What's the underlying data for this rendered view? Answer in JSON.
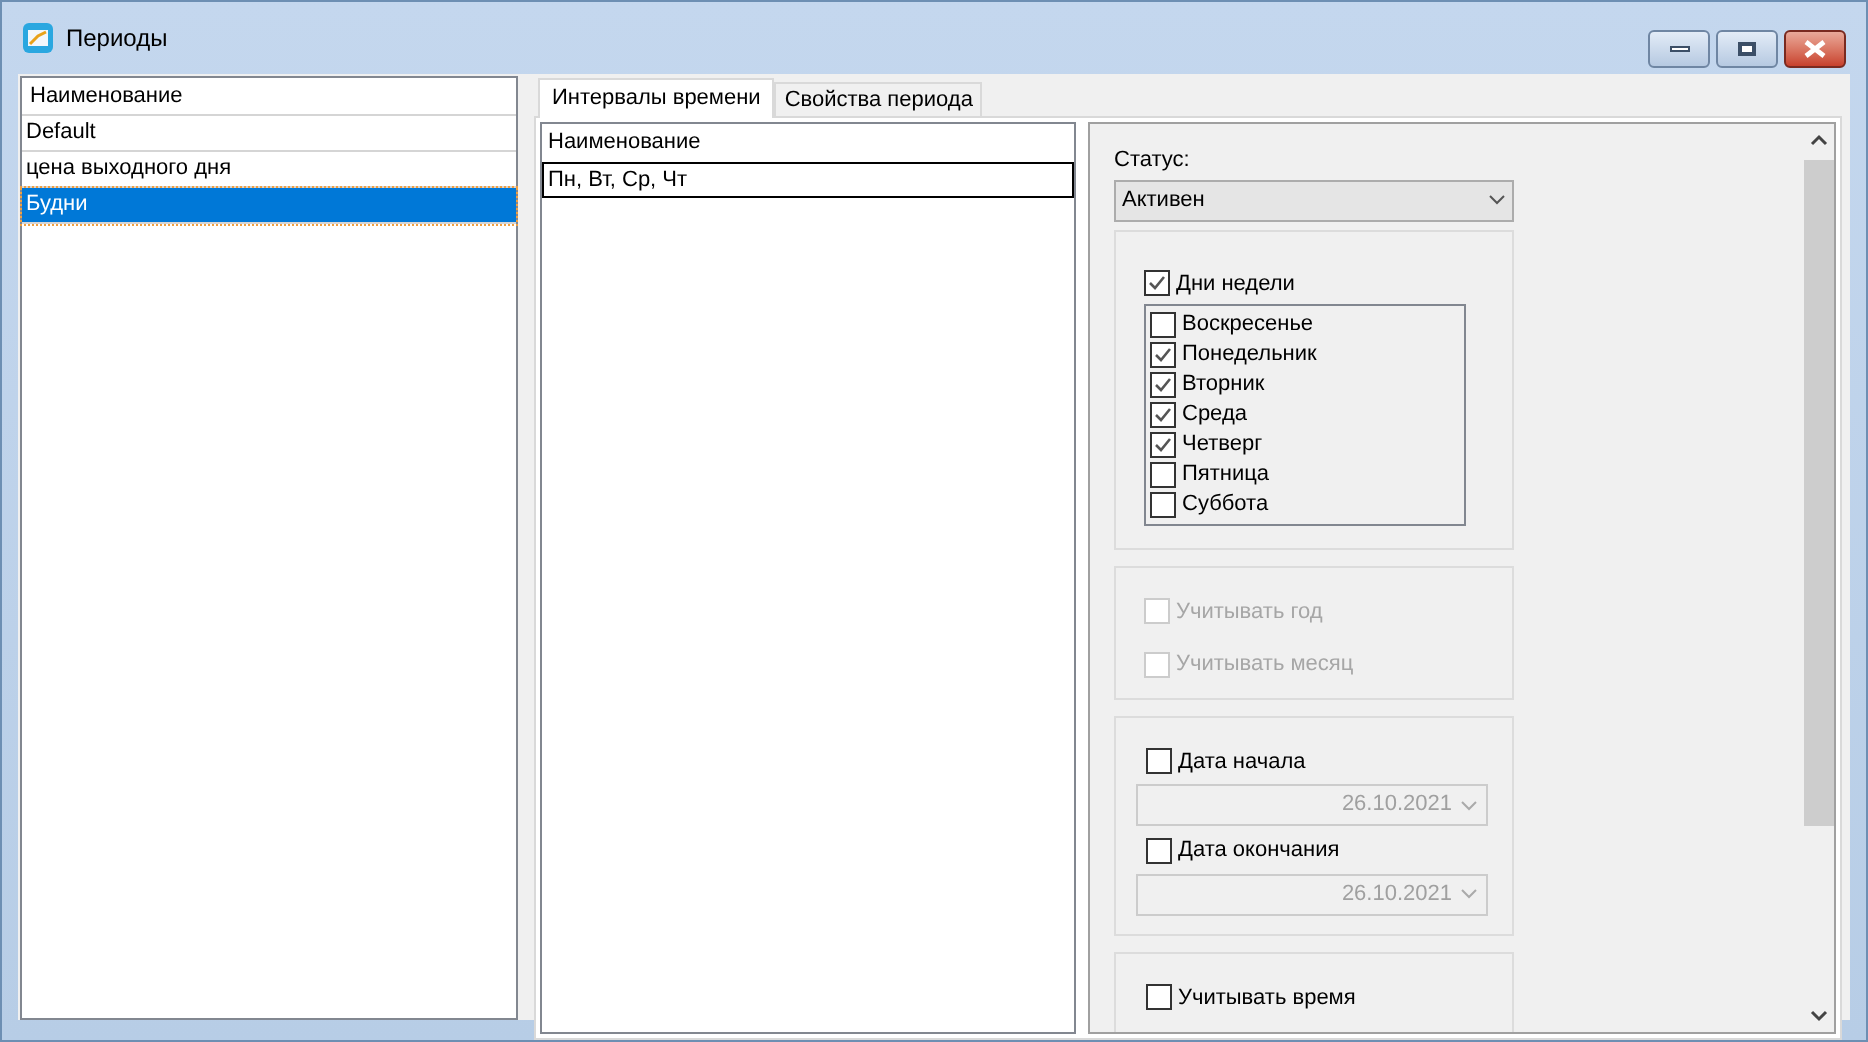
{
  "window": {
    "title": "Периоды"
  },
  "periods": {
    "header": "Наименование",
    "rows": [
      {
        "name": "Default",
        "selected": false
      },
      {
        "name": "цена выходного дня",
        "selected": false
      },
      {
        "name": "Будни",
        "selected": true
      }
    ]
  },
  "tabs": [
    {
      "label": "Интервалы времени",
      "selected": true
    },
    {
      "label": "Свойства периода",
      "selected": false
    }
  ],
  "intervals": {
    "header": "Наименование",
    "rows": [
      {
        "name": "Пн, Вт, Ср, Чт",
        "selected": true
      }
    ]
  },
  "properties": {
    "status_label": "Статус:",
    "status_value": "Активен",
    "days_group": {
      "label": "Дни недели",
      "checked": true,
      "days": [
        {
          "label": "Воскресенье",
          "checked": false
        },
        {
          "label": "Понедельник",
          "checked": true
        },
        {
          "label": "Вторник",
          "checked": true
        },
        {
          "label": "Среда",
          "checked": true
        },
        {
          "label": "Четверг",
          "checked": true
        },
        {
          "label": "Пятница",
          "checked": false
        },
        {
          "label": "Суббота",
          "checked": false
        }
      ]
    },
    "year_group": [
      {
        "label": "Учитывать год",
        "checked": false,
        "disabled": true
      },
      {
        "label": "Учитывать месяц",
        "checked": false,
        "disabled": true
      }
    ],
    "date_group": [
      {
        "label": "Дата начала",
        "checked": false,
        "date_field": "26.10.2021"
      },
      {
        "label": "Дата окончания",
        "checked": false,
        "date_field": "26.10.2021"
      }
    ],
    "time_group": {
      "label": "Учитывать время",
      "checked": false
    }
  }
}
